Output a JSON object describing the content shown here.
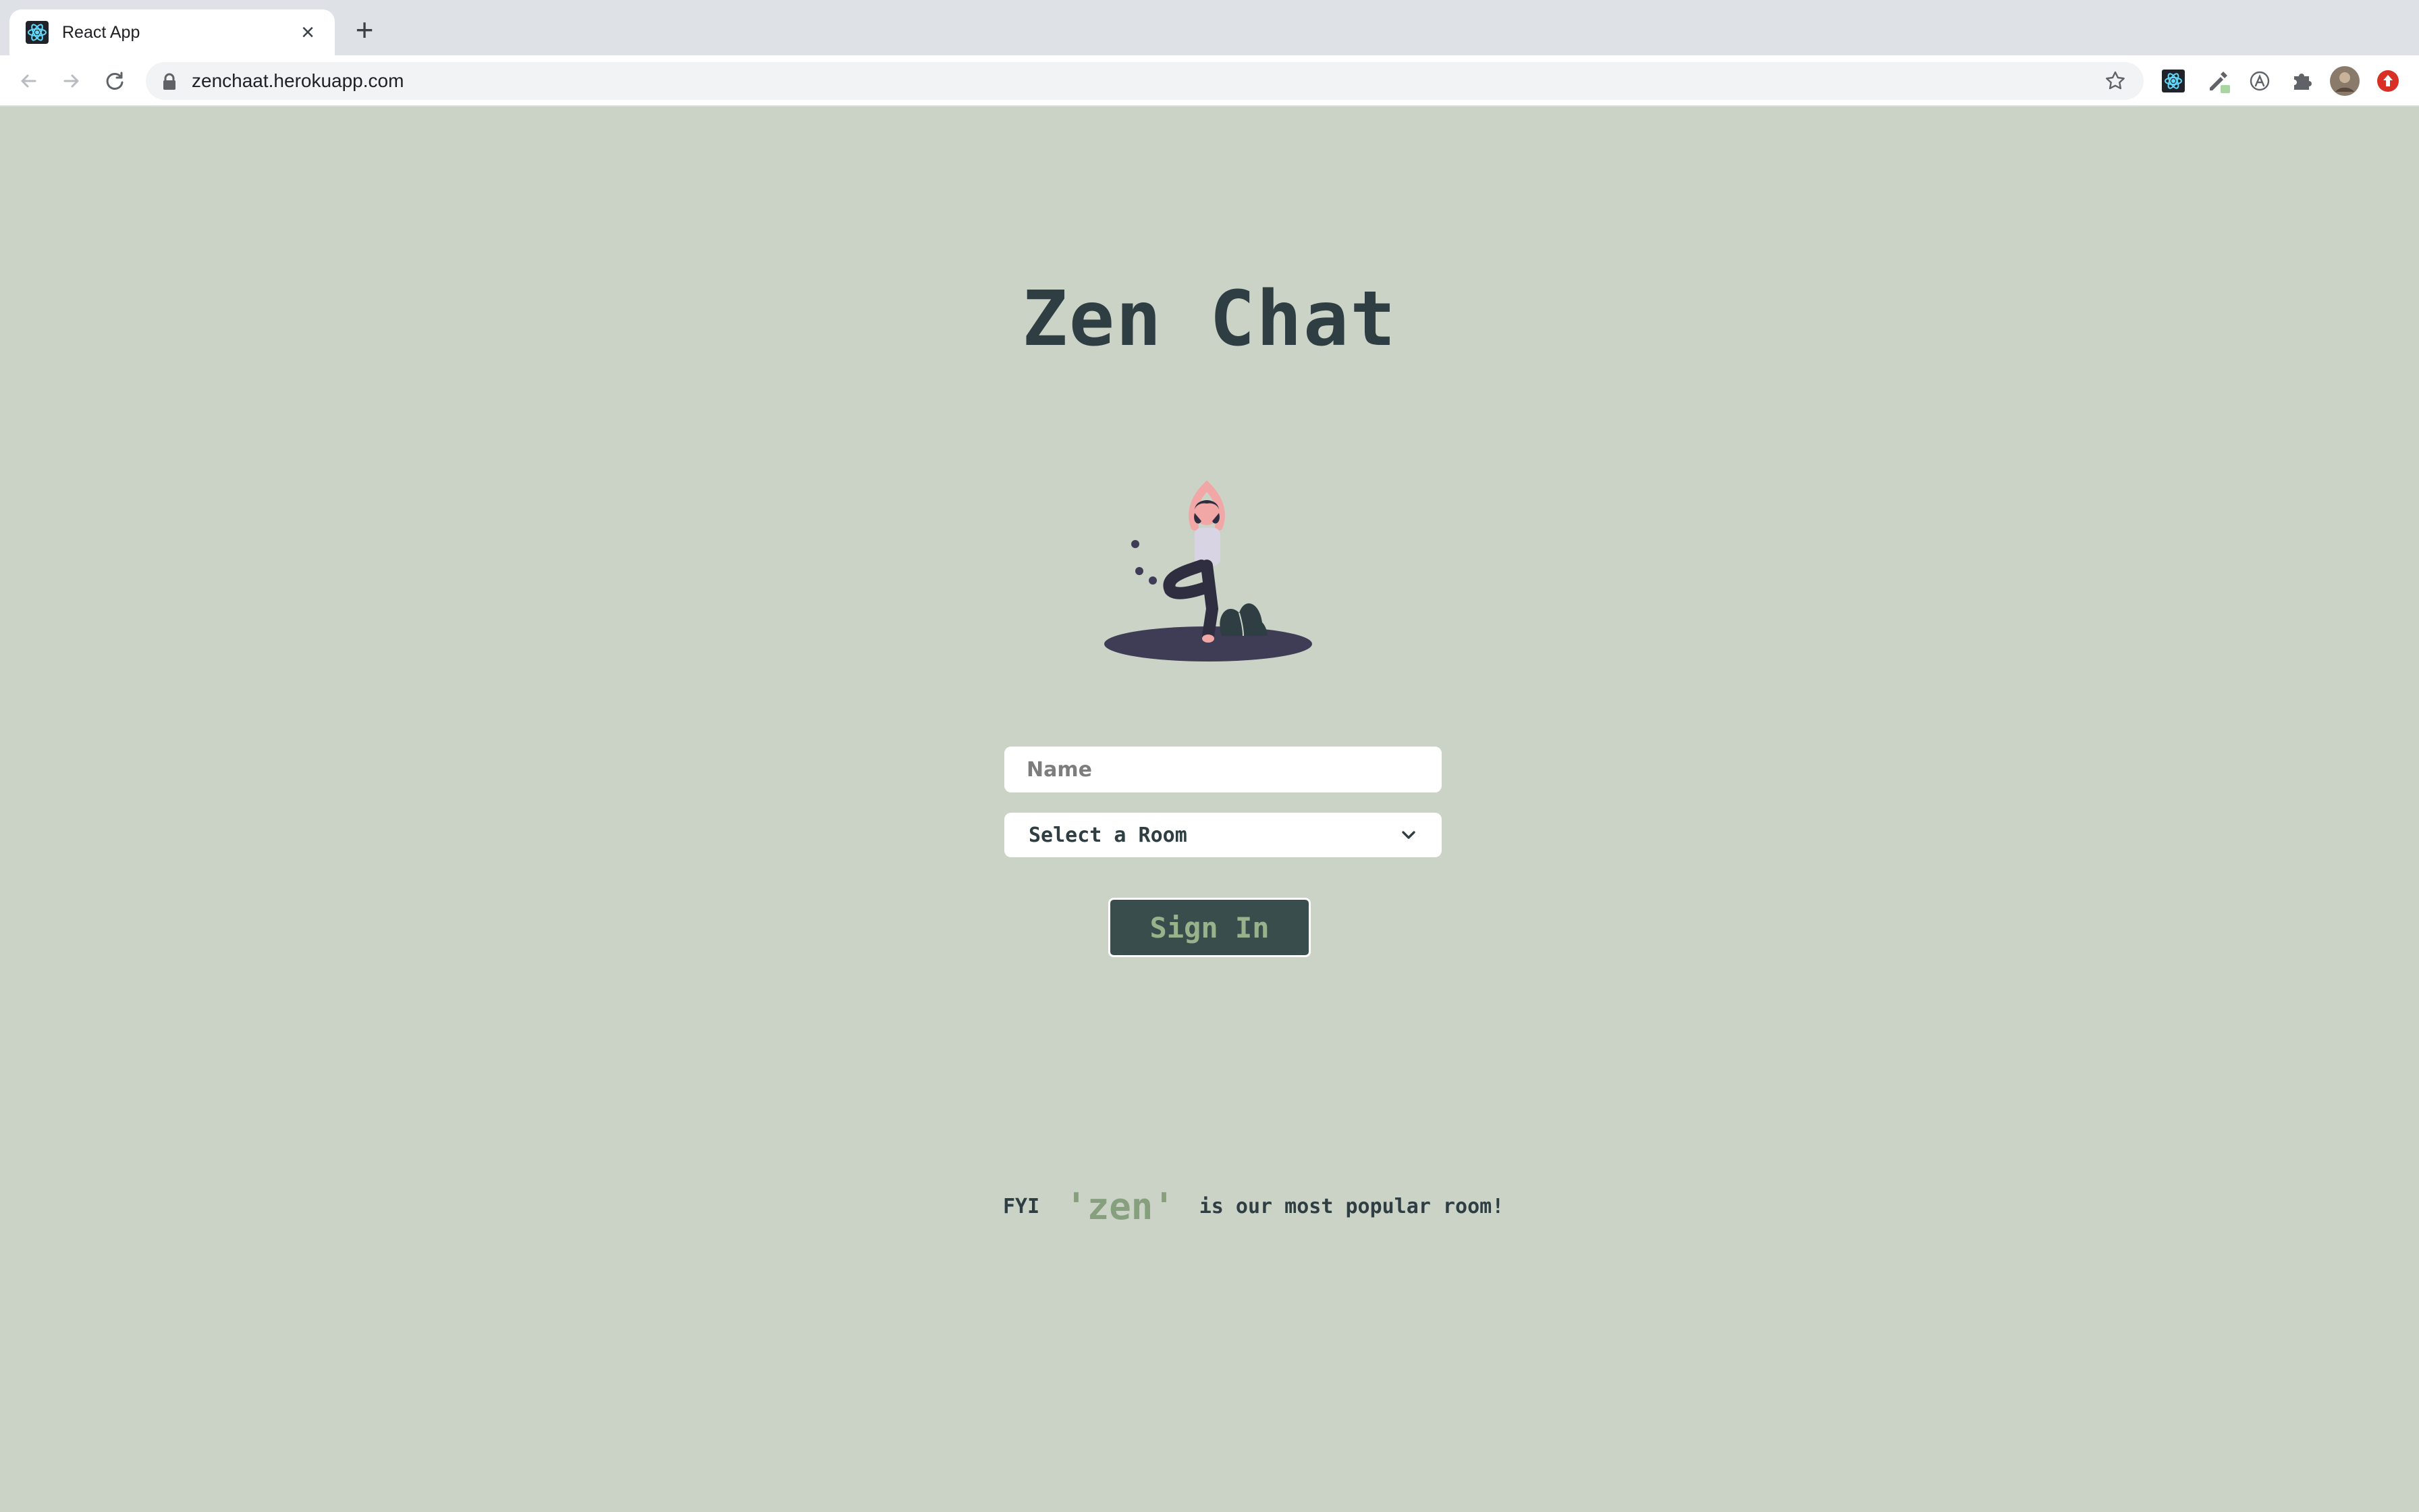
{
  "browser": {
    "tab_title": "React App",
    "tab_close": "×",
    "new_tab": "+",
    "url": "zenchaat.herokuapp.com"
  },
  "page": {
    "title": "Zen Chat",
    "name_placeholder": "Name",
    "room_select": "Select a Room",
    "sign_in": "Sign In",
    "fyi_lead": "FYI",
    "fyi_room": "'zen'",
    "fyi_tail": "is our most popular room!"
  },
  "colors": {
    "background": "#cbd3c7",
    "text_dark": "#2f3e43",
    "button_bg": "#3a4d4d",
    "accent_green": "#86a07e"
  },
  "icons": {
    "favicon": "react-icon",
    "back": "back-arrow-icon",
    "forward": "forward-arrow-icon",
    "reload": "reload-icon",
    "lock": "lock-icon",
    "bookmark": "star-icon",
    "extensions": "puzzle-icon",
    "select": "chevron-down-icon"
  }
}
